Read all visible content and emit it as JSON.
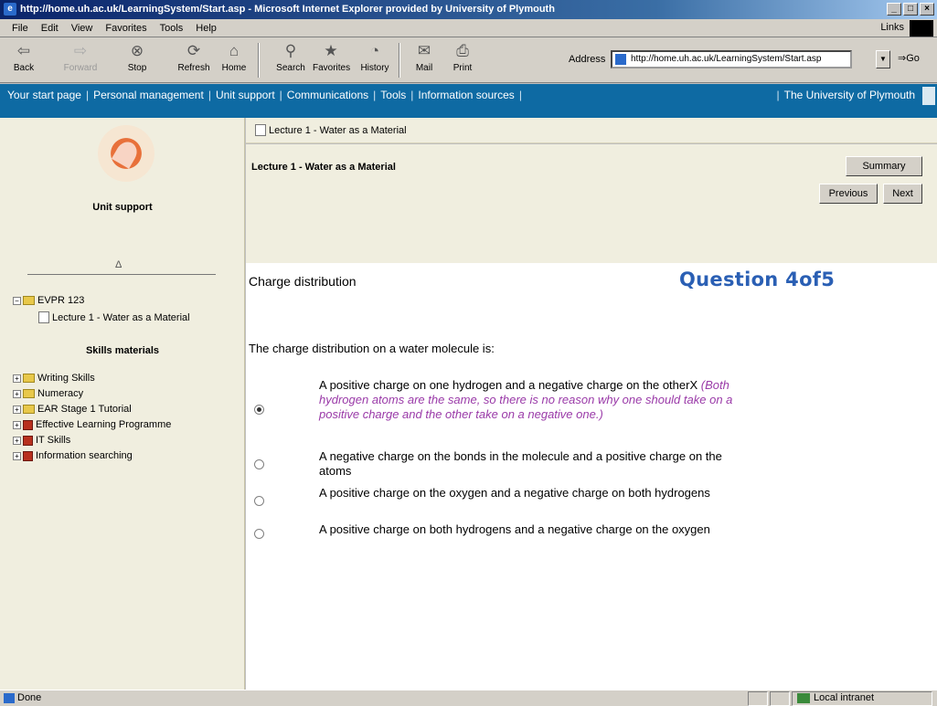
{
  "window": {
    "title": "http://home.uh.ac.uk/LearningSystem/Start.asp - Microsoft Internet Explorer provided by University of Plymouth"
  },
  "menu": {
    "items": [
      "File",
      "Edit",
      "View",
      "Favorites",
      "Tools",
      "Help"
    ],
    "links_label": "Links"
  },
  "toolbar": {
    "buttons": [
      {
        "label": "Back",
        "icon": "back-arrow-icon"
      },
      {
        "label": "Forward",
        "icon": "forward-arrow-icon"
      },
      {
        "label": "Stop",
        "icon": "stop-icon"
      },
      {
        "label": "Refresh",
        "icon": "refresh-icon"
      },
      {
        "label": "Home",
        "icon": "home-icon"
      },
      {
        "label": "Search",
        "icon": "search-icon"
      },
      {
        "label": "Favorites",
        "icon": "favorites-icon"
      },
      {
        "label": "History",
        "icon": "history-icon"
      },
      {
        "label": "Mail",
        "icon": "mail-icon"
      },
      {
        "label": "Print",
        "icon": "print-icon"
      }
    ],
    "address_label": "Address",
    "address_value": "http://home.uh.ac.uk/LearningSystem/Start.asp",
    "go_label": "Go"
  },
  "sitenav": {
    "items": [
      "Your start page",
      "Personal management",
      "Unit support",
      "Communications",
      "Tools",
      "Information sources"
    ],
    "university": "The University of Plymouth"
  },
  "sidebar": {
    "heading": "Unit support",
    "collapse_glyph": "Δ",
    "unit": "EVPR 123",
    "lecture": "Lecture 1 - Water as a Material",
    "skills_heading": "Skills materials",
    "skills": [
      {
        "label": "Writing Skills",
        "icon": "folder-icon"
      },
      {
        "label": "Numeracy",
        "icon": "folder-icon"
      },
      {
        "label": "EAR Stage 1 Tutorial",
        "icon": "folder-icon"
      },
      {
        "label": "Effective Learning Programme",
        "icon": "book-icon"
      },
      {
        "label": "IT Skills",
        "icon": "book-icon"
      },
      {
        "label": "Information searching",
        "icon": "book-icon"
      }
    ]
  },
  "main": {
    "breadcrumb": "Lecture 1 - Water as a Material",
    "lecture_title": "Lecture 1 - Water as a Material",
    "summary_label": "Summary",
    "previous_label": "Previous",
    "next_label": "Next",
    "question_heading": "Charge distribution",
    "question_counter": "Question 4of5",
    "question_text": "The charge distribution on a water molecule is:",
    "options": [
      {
        "text": "A positive charge on one hydrogen and a negative charge on the otherX",
        "feedback": " (Both hydrogen atoms are the same, so there is no reason why one should take on a positive charge and the other take on a negative one.)",
        "selected": true
      },
      {
        "text": "A negative charge on the bonds in the molecule and a positive charge on the atoms",
        "feedback": "",
        "selected": false
      },
      {
        "text": "A positive charge on the oxygen and a negative charge on both hydrogens",
        "feedback": "",
        "selected": false
      },
      {
        "text": "A positive charge on both hydrogens and a negative charge on the oxygen",
        "feedback": "",
        "selected": false
      }
    ]
  },
  "status": {
    "text": "Done",
    "zone": "Local intranet"
  }
}
